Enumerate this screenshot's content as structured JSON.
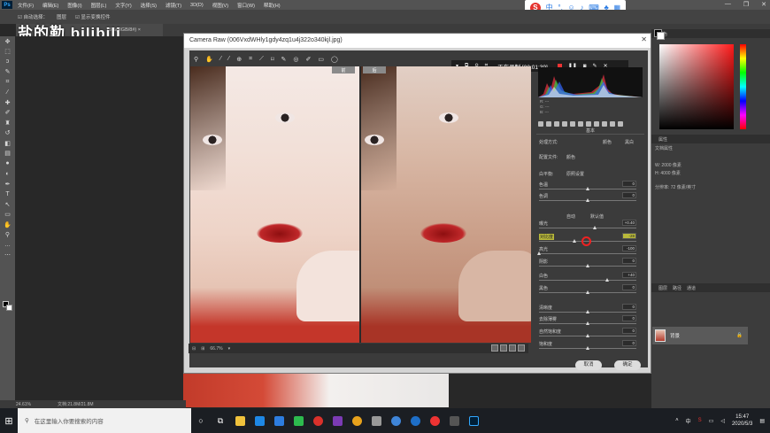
{
  "menubar": {
    "logo": "Ps",
    "items": [
      "文件(F)",
      "编辑(E)",
      "图像(I)",
      "图层(L)",
      "文字(Y)",
      "选择(S)",
      "滤镜(T)",
      "3D(D)",
      "视图(V)",
      "窗口(W)",
      "帮助(H)"
    ],
    "win_buttons": [
      "—",
      "❐",
      "✕"
    ]
  },
  "options_bar": {
    "auto_select": "☑ 自动选择：",
    "layer": "图层",
    "show_transform": "☑ 显示变换控件"
  },
  "watermark": "盐的勒 bilibili",
  "doc_tab": {
    "label": "75%(RGB/8#) ×"
  },
  "camera_raw": {
    "title": "Camera Raw (006VxdWHly1gdy4zq1u4j322o340kjl.jpg)",
    "before_label": "前",
    "after_label": "后",
    "recording": "正在录制 [00:01:39]",
    "zoom": "66.7%",
    "process_label": "处理方式:",
    "process_color": "颜色",
    "process_bw": "黑白",
    "profile_label": "配置文件:",
    "profile_value": "颜色",
    "section_title": "基本",
    "wb_label": "白平衡:",
    "wb_value": "原照设置",
    "auto_label": "自动",
    "default_label": "默认值",
    "sliders": [
      {
        "label": "色温",
        "value": "0",
        "pos": 0.5
      },
      {
        "label": "色调",
        "value": "0",
        "pos": 0.5
      },
      {
        "label": "曝光",
        "value": "+0.40",
        "pos": 0.57
      },
      {
        "label": "对比度",
        "value": "-28",
        "pos": 0.36,
        "highlight": true
      },
      {
        "label": "高光",
        "value": "-100",
        "pos": 0.0
      },
      {
        "label": "阴影",
        "value": "0",
        "pos": 0.5
      },
      {
        "label": "白色",
        "value": "+40",
        "pos": 0.7
      },
      {
        "label": "黑色",
        "value": "0",
        "pos": 0.5
      },
      {
        "label": "清晰度",
        "value": "0",
        "pos": 0.5
      },
      {
        "label": "去除薄雾",
        "value": "0",
        "pos": 0.5
      },
      {
        "label": "自然饱和度",
        "value": "0",
        "pos": 0.5
      },
      {
        "label": "饱和度",
        "value": "0",
        "pos": 0.5
      }
    ],
    "rgb_r": "R: ---",
    "rgb_g": "G: ---",
    "rgb_b": "B: ---",
    "cancel": "取消",
    "ok": "确定"
  },
  "right_panels": {
    "color_tab": "颜色",
    "props_tab": "属性",
    "props_title": "文档属性",
    "props_w": "W: 2000 像素",
    "props_h": "H: 4000 像素",
    "props_res": "分辨率: 72 像素/英寸",
    "layers_tab": "图层",
    "paths_tab": "路径",
    "channels_tab": "通道",
    "layer_name": "背景"
  },
  "status": {
    "zoom": "24.61%",
    "doc": "文档:21.8M/21.8M"
  },
  "taskbar": {
    "search_placeholder": "在这里输入你要搜索的内容",
    "time": "15:47",
    "date": "2020/5/3",
    "ime": "中"
  }
}
